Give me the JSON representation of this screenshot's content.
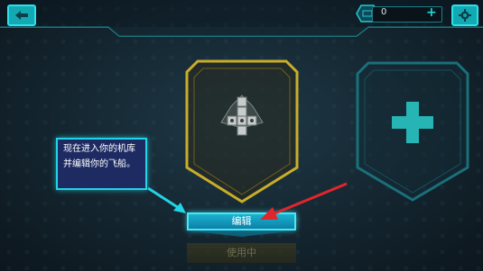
{
  "topbar": {
    "currency_value": "0"
  },
  "tooltip": {
    "text": "现在进入你的机库并编辑你的飞船。"
  },
  "buttons": {
    "edit_label": "编辑",
    "in_use_label": "使用中"
  },
  "colors": {
    "accent_cyan": "#2ee0ea",
    "active_card_gold": "#c9ad2a",
    "tooltip_bg": "#1e2b63",
    "arrow_red": "#e0262c"
  },
  "icons": {
    "back": "back-arrow-icon",
    "settings": "gear-icon",
    "currency": "hexagon-currency-icon",
    "add_currency": "plus-icon",
    "add_ship": "plus-icon",
    "ship": "spaceship-icon"
  }
}
